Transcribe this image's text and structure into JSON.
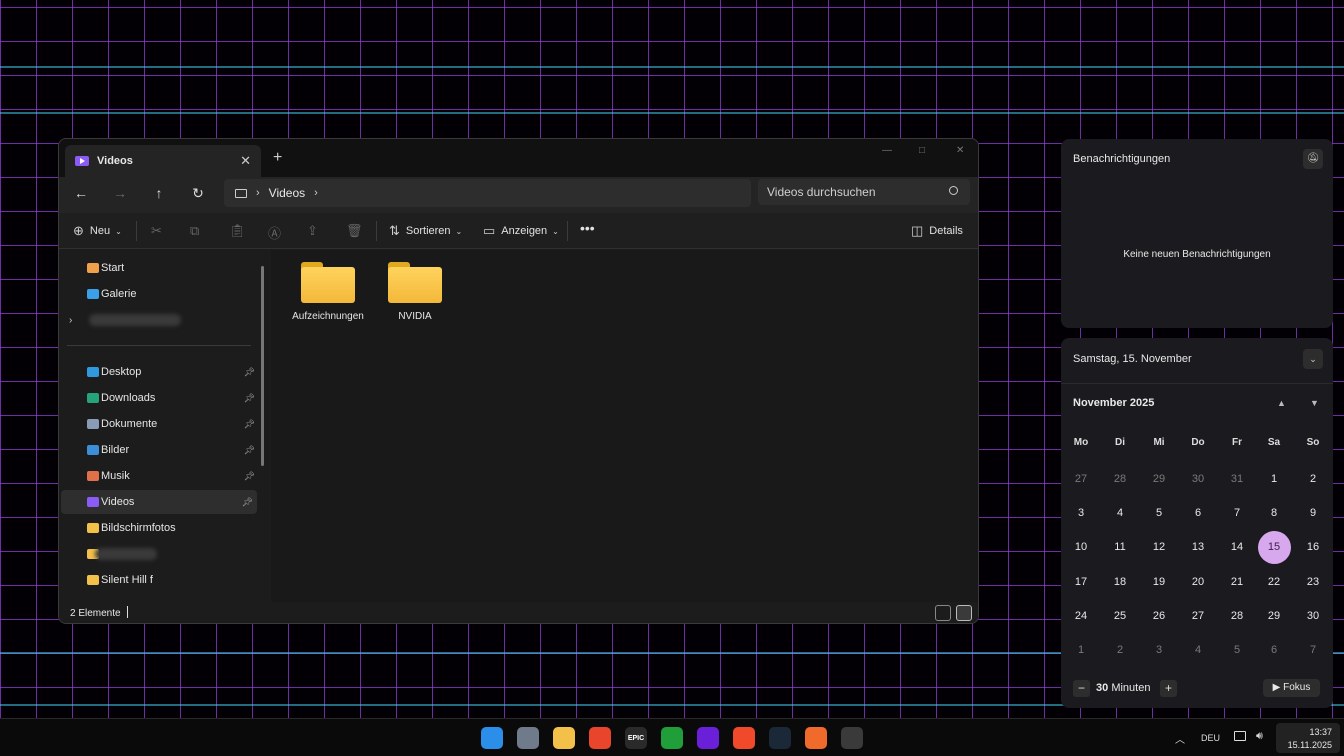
{
  "explorer": {
    "tab_title": "Videos",
    "address": {
      "segments": [
        "Videos"
      ]
    },
    "search_placeholder": "Videos durchsuchen",
    "toolbar": {
      "new_label": "Neu",
      "sort_label": "Sortieren",
      "view_label": "Anzeigen",
      "details_label": "Details"
    },
    "sidebar": {
      "top_items": [
        {
          "label": "Start",
          "icon": "home-icon",
          "color": "#f0a04a"
        },
        {
          "label": "Galerie",
          "icon": "gallery-icon",
          "color": "#3aa0e8"
        }
      ],
      "pinned_items": [
        {
          "label": "Desktop",
          "icon": "desktop-folder-icon",
          "color": "#2f9ae0"
        },
        {
          "label": "Downloads",
          "icon": "downloads-folder-icon",
          "color": "#26a37a"
        },
        {
          "label": "Dokumente",
          "icon": "documents-folder-icon",
          "color": "#8a9bb5"
        },
        {
          "label": "Bilder",
          "icon": "pictures-folder-icon",
          "color": "#3b8fd8"
        },
        {
          "label": "Musik",
          "icon": "music-folder-icon",
          "color": "#e0704a"
        },
        {
          "label": "Videos",
          "icon": "videos-folder-icon",
          "color": "#8a5cf5"
        }
      ],
      "other_items": [
        {
          "label": "Bildschirmfotos",
          "icon": "folder-icon",
          "color": "#f3c14a"
        },
        {
          "label": "Silent Hill f",
          "icon": "folder-icon",
          "color": "#f3c14a"
        }
      ]
    },
    "folders": [
      {
        "label": "Aufzeichnungen"
      },
      {
        "label": "NVIDIA"
      }
    ],
    "status": {
      "item_count": "2 Elemente"
    }
  },
  "notifications": {
    "title": "Benachrichtigungen",
    "empty_text": "Keine neuen Benachrichtigungen"
  },
  "calendar": {
    "date_header": "Samstag, 15. November",
    "month_label": "November 2025",
    "weekdays": [
      "Mo",
      "Di",
      "Mi",
      "Do",
      "Fr",
      "Sa",
      "So"
    ],
    "weeks": [
      [
        "27",
        "28",
        "29",
        "30",
        "31",
        "1",
        "2"
      ],
      [
        "3",
        "4",
        "5",
        "6",
        "7",
        "8",
        "9"
      ],
      [
        "10",
        "11",
        "12",
        "13",
        "14",
        "15",
        "16"
      ],
      [
        "17",
        "18",
        "19",
        "20",
        "21",
        "22",
        "23"
      ],
      [
        "24",
        "25",
        "26",
        "27",
        "28",
        "29",
        "30"
      ],
      [
        "1",
        "2",
        "3",
        "4",
        "5",
        "6",
        "7"
      ]
    ],
    "today": "15",
    "accent_color": "#d8a8ee",
    "focus": {
      "value": "30",
      "unit": "Minuten",
      "button_label": "Fokus"
    }
  },
  "taskbar": {
    "apps": [
      {
        "name": "start-icon",
        "color": "#2b8ee8"
      },
      {
        "name": "settings-icon",
        "color": "#6f7b8a"
      },
      {
        "name": "file-explorer-icon",
        "color": "#f3c14a"
      },
      {
        "name": "ea-app-icon",
        "color": "#e8452c"
      },
      {
        "name": "epic-games-icon",
        "color": "#2a2a2a",
        "text": "EPIC"
      },
      {
        "name": "xbox-icon",
        "color": "#1f9e3a"
      },
      {
        "name": "cortana-ring-icon",
        "color": "#6a1fd8"
      },
      {
        "name": "brave-browser-icon",
        "color": "#f04a2b"
      },
      {
        "name": "steam-icon",
        "color": "#1b2838"
      },
      {
        "name": "firefox-icon",
        "color": "#f06a2b"
      },
      {
        "name": "eagle-app-icon",
        "color": "#3a3a3a"
      }
    ],
    "tray": {
      "language": "DEU",
      "time": "13:37",
      "date": "15.11.2025"
    }
  }
}
